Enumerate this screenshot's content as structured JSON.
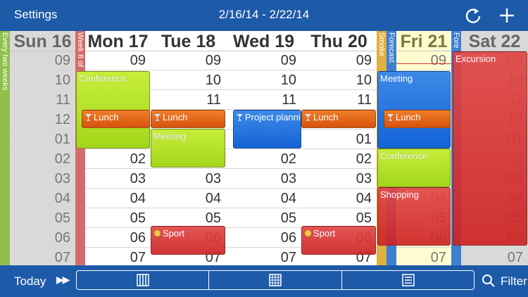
{
  "topbar": {
    "settings_label": "Settings",
    "date_range": "2/16/14 - 2/22/14",
    "refresh_icon": "refresh-icon",
    "add_icon": "plus-icon"
  },
  "days": [
    {
      "name": "Sun 16",
      "hours": [
        "09",
        "10",
        "11",
        "12",
        "01",
        "02",
        "03",
        "04",
        "05",
        "06",
        "07"
      ],
      "state": "past"
    },
    {
      "name": "Mon 17",
      "hours": [
        "09",
        "10",
        "11",
        "12",
        "01",
        "02",
        "03",
        "04",
        "05",
        "06",
        "07"
      ],
      "state": "normal"
    },
    {
      "name": "Tue 18",
      "hours": [
        "09",
        "10",
        "11",
        "12",
        "01",
        "02",
        "03",
        "04",
        "05",
        "06",
        "07"
      ],
      "state": "normal"
    },
    {
      "name": "Wed 19",
      "hours": [
        "09",
        "10",
        "11",
        "12",
        "01",
        "02",
        "03",
        "04",
        "05",
        "06",
        "07"
      ],
      "state": "normal"
    },
    {
      "name": "Thu 20",
      "hours": [
        "09",
        "10",
        "11",
        "12",
        "01",
        "02",
        "03",
        "04",
        "05",
        "06",
        "07"
      ],
      "state": "normal"
    },
    {
      "name": "Fri 21",
      "hours": [
        "09",
        "10",
        "11",
        "12",
        "01",
        "02",
        "03",
        "04",
        "05",
        "06",
        "07"
      ],
      "state": "today"
    },
    {
      "name": "Sat 22",
      "hours": [
        "09",
        "10",
        "11",
        "12",
        "01",
        "02",
        "03",
        "04",
        "05",
        "06",
        "07"
      ],
      "state": "past"
    }
  ],
  "strips": [
    {
      "label": "Every two weeks",
      "color": "#8fbf4a"
    },
    {
      "label": "Week 8 of",
      "color": "#d46b6b"
    },
    {
      "label": "Smoke",
      "color": "#e0b040"
    },
    {
      "label": "Forecast",
      "color": "#3f7fd0"
    },
    {
      "label": "Fore",
      "color": "#3f7fd0"
    }
  ],
  "events": [
    {
      "title": "Conference",
      "color": "green",
      "icon": ""
    },
    {
      "title": "Lunch",
      "color": "orange",
      "icon": "glass-icon"
    },
    {
      "title": "Lunch",
      "color": "orange",
      "icon": "glass-icon"
    },
    {
      "title": "Meeting",
      "color": "green",
      "icon": ""
    },
    {
      "title": "Project planning",
      "color": "blue",
      "icon": "glass-icon"
    },
    {
      "title": "Lunch",
      "color": "orange",
      "icon": "glass-icon"
    },
    {
      "title": "Meeting",
      "color": "blue",
      "icon": ""
    },
    {
      "title": "Lunch",
      "color": "orange",
      "icon": "glass-icon"
    },
    {
      "title": "Conference",
      "color": "green",
      "icon": ""
    },
    {
      "title": "Shopping",
      "color": "red",
      "icon": ""
    },
    {
      "title": "Excursion",
      "color": "red",
      "icon": ""
    },
    {
      "title": "Sport",
      "color": "red",
      "icon": "ball-icon"
    },
    {
      "title": "Sport",
      "color": "red",
      "icon": "ball-icon"
    }
  ],
  "bottombar": {
    "today_label": "Today",
    "forward_icon": "fast-forward-icon",
    "views": [
      "week-columns-icon",
      "month-grid-icon",
      "list-icon"
    ],
    "filter_icon": "search-icon",
    "filter_label": "Filter"
  },
  "colors": {
    "bar": "#1d5aa8",
    "today_bg": "#fdfbd0",
    "past_bg": "#d9d9d9"
  }
}
